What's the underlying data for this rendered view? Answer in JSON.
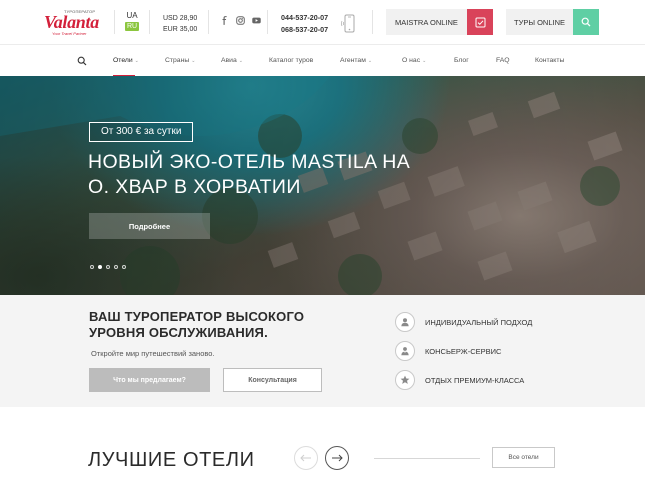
{
  "header": {
    "logo": {
      "top": "ТУРОПЕРАТОР",
      "main": "Valanta",
      "sub": "Your Travel Partner"
    },
    "languages": {
      "ua": "UA",
      "ru": "RU"
    },
    "rates": {
      "usd": "USD 28,90",
      "eur": "EUR 35,00"
    },
    "socials": [
      "facebook-icon",
      "instagram-icon",
      "youtube-icon"
    ],
    "phones": [
      "044-537-20-07",
      "068-537-20-07"
    ],
    "maistra_label": "MAISTRA ONLINE",
    "tours_label": "ТУРЫ ONLINE",
    "colors": {
      "brand": "#d3203a",
      "maistra": "#d9435a",
      "tours": "#5fcfa4",
      "lang_active": "#8cc63f"
    }
  },
  "nav": {
    "items": [
      {
        "label": "Отели",
        "caret": "⌄",
        "active": true
      },
      {
        "label": "Страны",
        "caret": "⌄"
      },
      {
        "label": "Авиа",
        "caret": "⌄"
      },
      {
        "label": "Каталог туров",
        "caret": ""
      },
      {
        "label": "Агентам",
        "caret": "⌄"
      },
      {
        "label": "О нас",
        "caret": "⌄"
      },
      {
        "label": "Блог",
        "caret": ""
      },
      {
        "label": "FAQ",
        "caret": ""
      },
      {
        "label": "Контакты",
        "caret": ""
      }
    ]
  },
  "hero": {
    "price": "От 300 € за сутки",
    "title": "НОВЫЙ ЭКО-ОТЕЛЬ MASTILA НА О. ХВАР В ХОРВАТИИ",
    "button": "Подробнее",
    "slides": 5,
    "active_slide": 2
  },
  "services": {
    "title": "ВАШ ТУРОПЕРАТОР ВЫСОКОГО УРОВНЯ ОБСЛУЖИВАНИЯ.",
    "subtitle": "Откройте мир путешествий заново.",
    "button_primary": "Что мы предлагаем?",
    "button_secondary": "Консультация",
    "features": [
      {
        "icon": "person-icon",
        "label": "ИНДИВИДУАЛЬНЫЙ ПОДХОД"
      },
      {
        "icon": "concierge-icon",
        "label": "КОНСЬЕРЖ-СЕРВИС"
      },
      {
        "icon": "star-icon",
        "label": "ОТДЫХ ПРЕМИУМ-КЛАССА"
      }
    ]
  },
  "best_hotels": {
    "title": "ЛУЧШИЕ ОТЕЛИ",
    "all_label": "Все отели"
  }
}
